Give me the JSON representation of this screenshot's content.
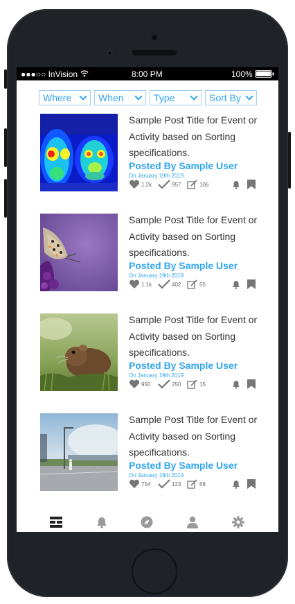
{
  "status": {
    "carrier": "●●●○○ InVision",
    "time": "8:00 PM",
    "battery": "100%"
  },
  "filters": [
    {
      "label": "Where"
    },
    {
      "label": "When"
    },
    {
      "label": "Type"
    },
    {
      "label": "Sort By"
    }
  ],
  "posts": [
    {
      "title": "Sample Post Title for Event or Activity based on Sorting specifications.",
      "author": "Posted By Sample User",
      "date": "On January 19th 2019",
      "likes": "1.2k",
      "checks": "957",
      "edits": "106",
      "image": "thermal-image"
    },
    {
      "title": "Sample Post Title for Event or Activity based on Sorting specifications.",
      "author": "Posted By Sample User",
      "date": "On January 19th 2019",
      "likes": "1.1k",
      "checks": "402",
      "edits": "55",
      "image": "butterfly-photo"
    },
    {
      "title": "Sample Post Title for Event or Activity based on Sorting specifications.",
      "author": "Posted By Sample User",
      "date": "On January 19th 2019",
      "likes": "950",
      "checks": "250",
      "edits": "15",
      "image": "vole-photo"
    },
    {
      "title": "Sample Post Title for Event or Activity based on Sorting specifications.",
      "author": "Posted By Sample User",
      "date": "On January 19th 2019",
      "likes": "754",
      "checks": "123",
      "edits": "68",
      "image": "street-photo"
    }
  ],
  "nav": [
    {
      "icon": "list-icon",
      "active": true
    },
    {
      "icon": "bell-icon",
      "active": false
    },
    {
      "icon": "compass-icon",
      "active": false
    },
    {
      "icon": "user-icon",
      "active": false
    },
    {
      "icon": "gear-icon",
      "active": false
    }
  ],
  "colors": {
    "accent": "#2fa5f0",
    "active_nav": "#222222",
    "inactive_nav": "#9a9a9a",
    "text": "#333333"
  }
}
